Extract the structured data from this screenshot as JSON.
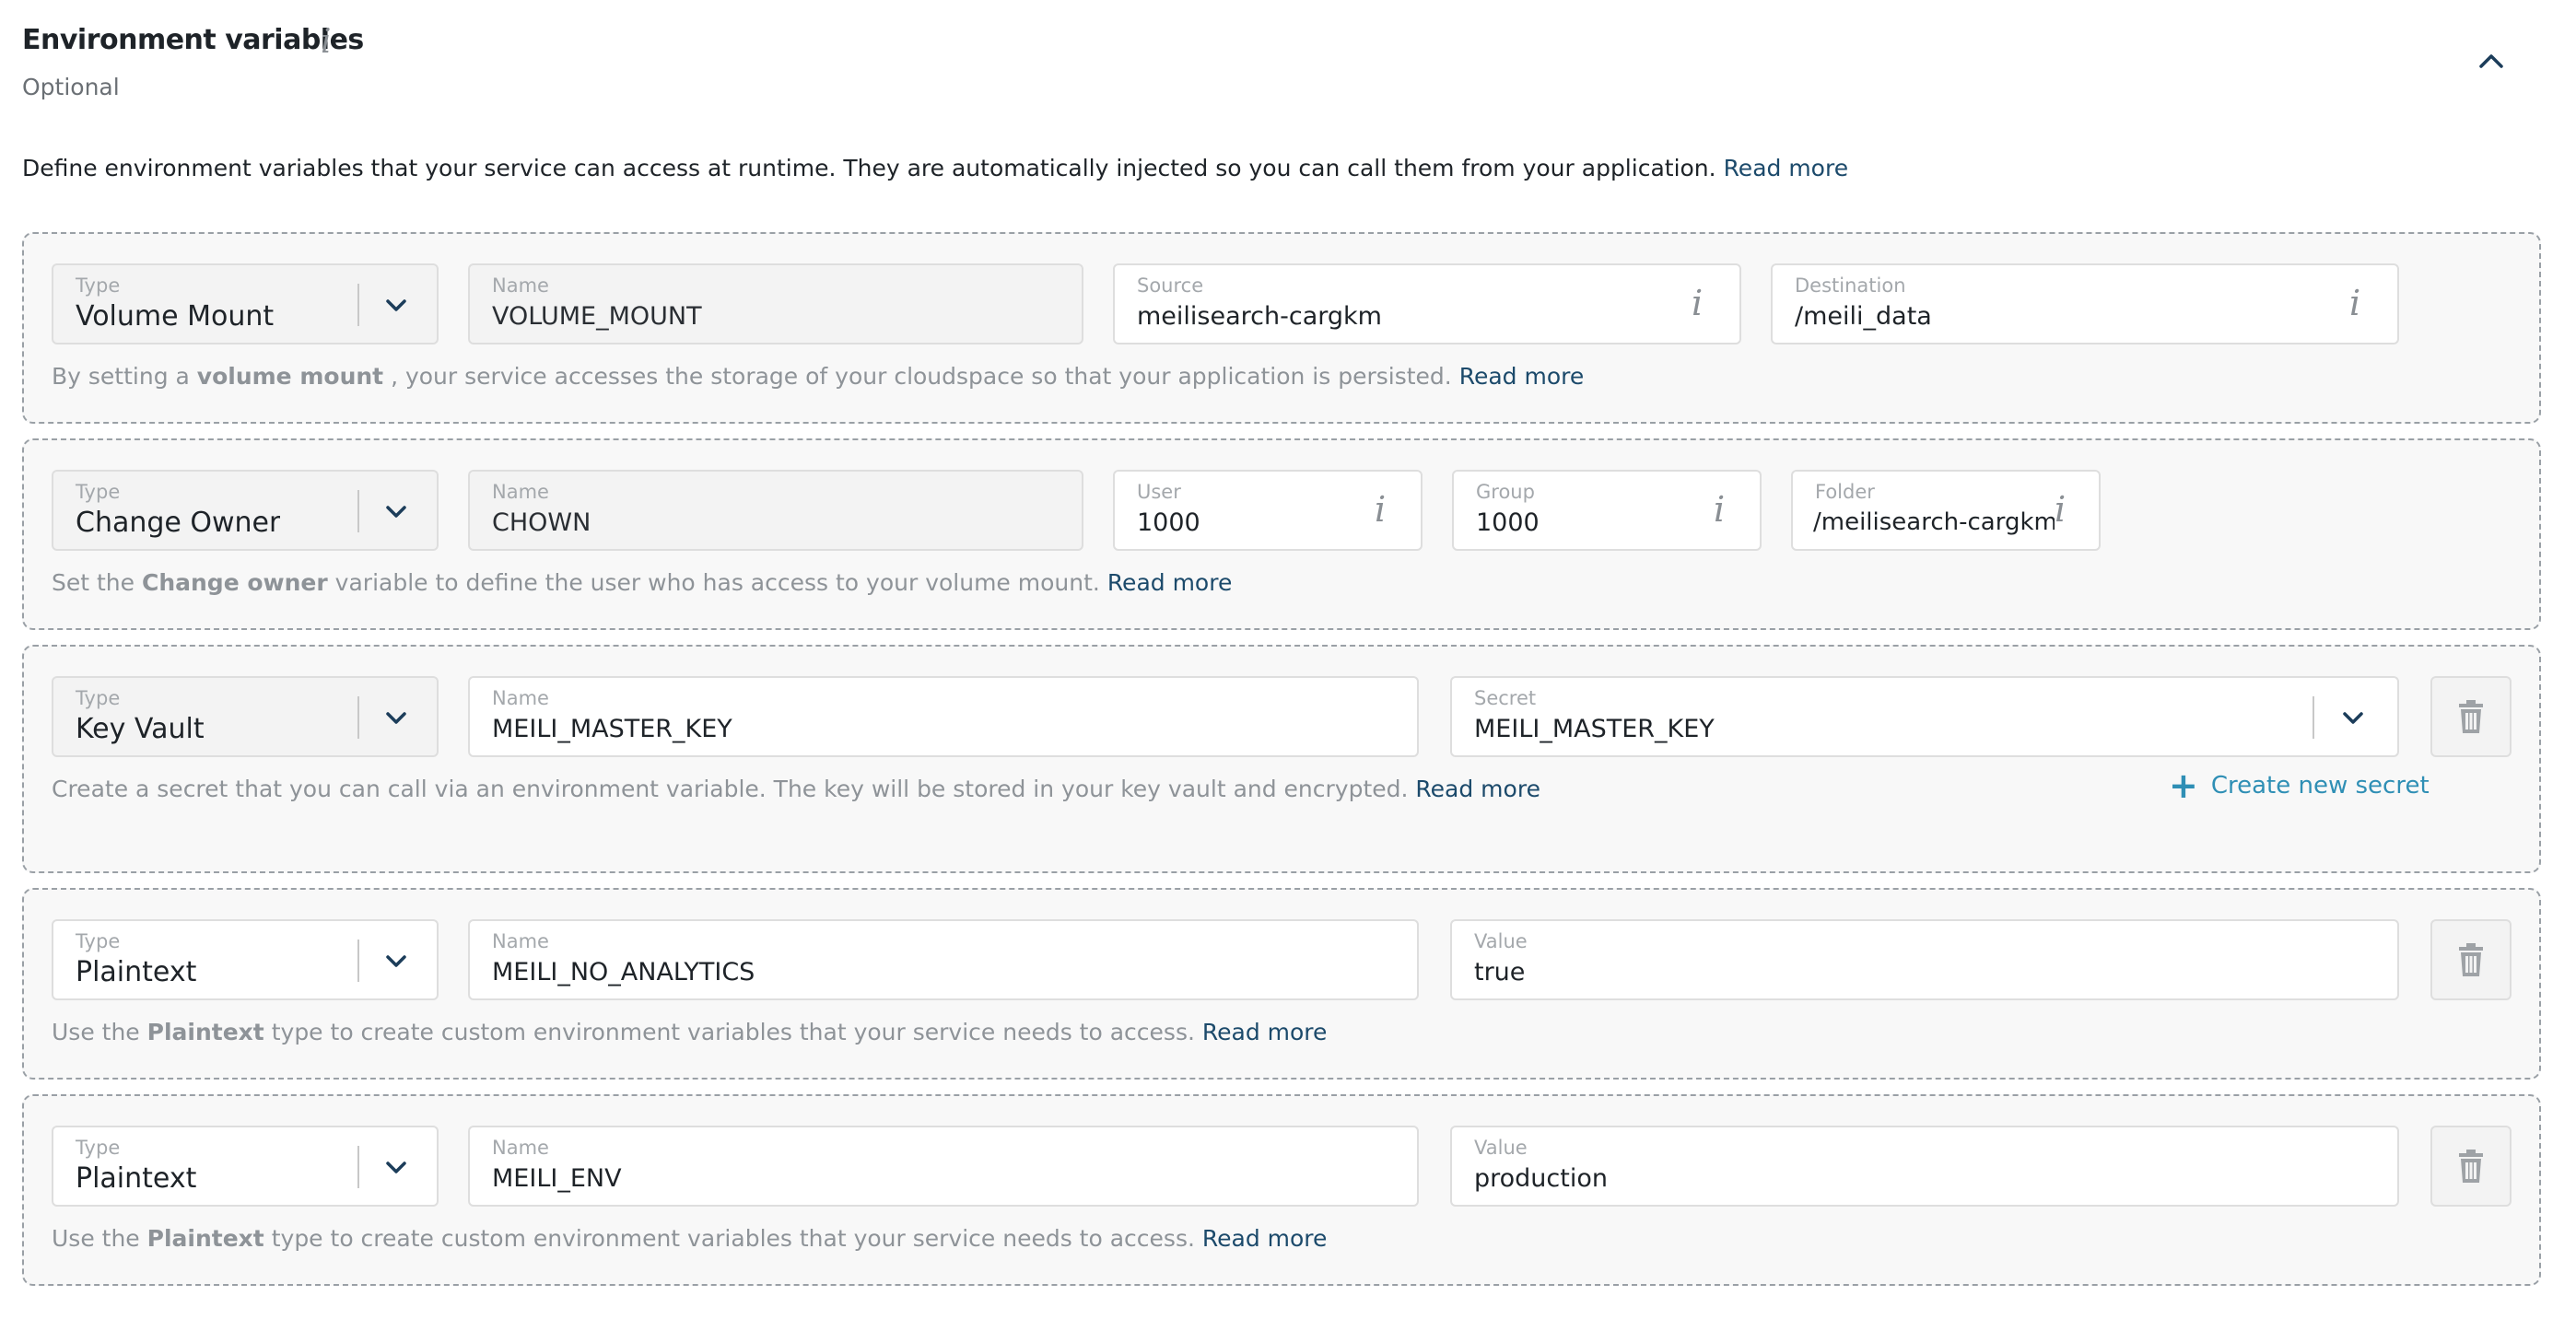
{
  "header": {
    "title": "Environment variables",
    "info_glyph": "i",
    "subtitle": "Optional",
    "description": "Define environment variables that your service can access at runtime. They are automatically injected so you can call them from your application.",
    "read_more": "Read more",
    "collapse_icon": "chevron-up-icon"
  },
  "blocks": [
    {
      "type_label": "Type",
      "type_value": "Volume Mount",
      "name_label": "Name",
      "name_value": "VOLUME_MOUNT",
      "fields": [
        {
          "label": "Source",
          "value": "meilisearch-cargkm"
        },
        {
          "label": "Destination",
          "value": "/meili_data"
        }
      ],
      "hint_pre": "By setting a",
      "hint_bold": "volume mount",
      "hint_post": ", your service accesses the storage of your cloudspace so that your application is persisted.",
      "read_more": "Read more"
    },
    {
      "type_label": "Type",
      "type_value": "Change Owner",
      "name_label": "Name",
      "name_value": "CHOWN",
      "fields": [
        {
          "label": "User",
          "value": "1000"
        },
        {
          "label": "Group",
          "value": "1000"
        },
        {
          "label": "Folder",
          "value": "/meilisearch-cargkm"
        }
      ],
      "hint_pre": "Set the",
      "hint_bold": "Change owner",
      "hint_post": "variable to define the user who has access to your volume mount.",
      "read_more": "Read more"
    },
    {
      "type_label": "Type",
      "type_value": "Key Vault",
      "name_label": "Name",
      "name_value": "MEILI_MASTER_KEY",
      "secret_label": "Secret",
      "secret_value": "MEILI_MASTER_KEY",
      "hint_text": "Create a secret that you can call via an environment variable. The key will be stored in your key vault and encrypted.",
      "read_more": "Read more",
      "create_secret": "Create new secret"
    },
    {
      "type_label": "Type",
      "type_value": "Plaintext",
      "name_label": "Name",
      "name_value": "MEILI_NO_ANALYTICS",
      "value_label": "Value",
      "value_value": "true",
      "hint_pre": "Use the",
      "hint_bold": "Plaintext",
      "hint_post": "type to create custom environment variables that your service needs to access.",
      "read_more": "Read more"
    },
    {
      "type_label": "Type",
      "type_value": "Plaintext",
      "name_label": "Name",
      "name_value": "MEILI_ENV",
      "value_label": "Value",
      "value_value": "production",
      "hint_pre": "Use the",
      "hint_bold": "Plaintext",
      "hint_post": "type to create custom environment variables that your service needs to access.",
      "read_more": "Read more"
    }
  ],
  "colors": {
    "link": "#1c4a6b",
    "create_link": "#2f8fb5",
    "chevron": "#1c3d5a",
    "muted_text": "#8e9398"
  }
}
